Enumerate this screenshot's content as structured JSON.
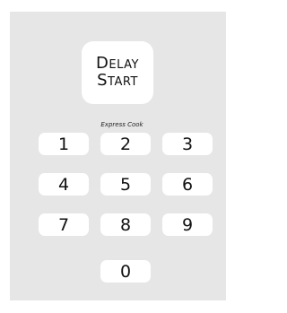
{
  "delay_start": {
    "line1": "Delay",
    "line2": "Start"
  },
  "express_cook_label": "Express Cook",
  "keypad": {
    "keys": [
      "1",
      "2",
      "3",
      "4",
      "5",
      "6",
      "7",
      "8",
      "9",
      "0"
    ]
  },
  "colors": {
    "panel": "#e6e6e6",
    "button": "#ffffff",
    "text": "#111111"
  }
}
